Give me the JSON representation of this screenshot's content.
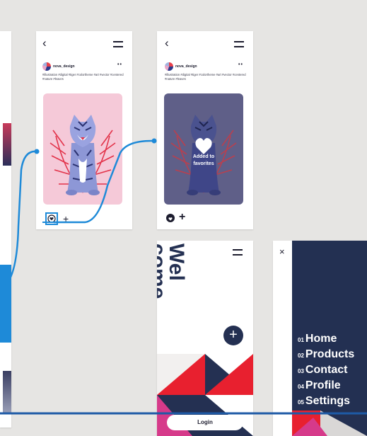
{
  "app": {
    "canvas_color": "#e6e5e3",
    "accent_color": "#1e8ad8",
    "navy_color": "#233052"
  },
  "screen_post": {
    "back_icon": "chevron-left-icon",
    "menu_icon": "hamburger-icon",
    "username": "nova_design",
    "more_icon": "more-dots-icon",
    "more_label": "••",
    "tags": "#illustration #digital #tiger #colortheme #art #vector #centered #nature #leaves",
    "artwork": "tiger-illustration",
    "like_icon": "heart-icon",
    "add_icon": "plus-icon"
  },
  "screen_favorited": {
    "username": "nova_design",
    "more_label": "••",
    "tags": "#illustration #digital #tiger #colortheme #art #vector #centered #nature #leaves",
    "overlay_text": "Added to favorites",
    "like_icon": "heart-icon",
    "add_icon": "plus-icon",
    "add_label": "+"
  },
  "screen_welcome": {
    "title_line1": "Wel",
    "title_line2": "come.",
    "fab_label": "+",
    "login_label": "Login"
  },
  "screen_menu": {
    "close_label": "×",
    "items": [
      {
        "num": "01",
        "label": "Home"
      },
      {
        "num": "02",
        "label": "Products"
      },
      {
        "num": "03",
        "label": "Contact"
      },
      {
        "num": "04",
        "label": "Profile"
      },
      {
        "num": "05",
        "label": "Settings"
      }
    ]
  }
}
